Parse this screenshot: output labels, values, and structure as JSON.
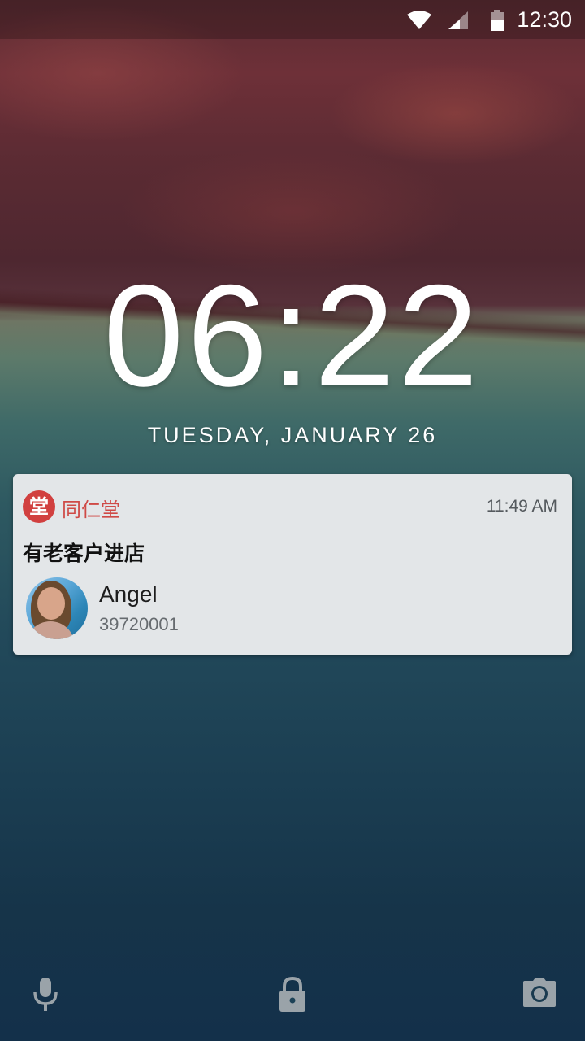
{
  "status_bar": {
    "time": "12:30",
    "icons": [
      "wifi-icon",
      "signal-icon",
      "battery-icon"
    ]
  },
  "lockscreen": {
    "clock": "06:22",
    "date": "TUESDAY, JANUARY 26"
  },
  "notification": {
    "app_icon": "tong-ren-tang-logo",
    "app_icon_glyph": "堂",
    "app_name": "同仁堂",
    "time": "11:49 AM",
    "title": "有老客户进店",
    "contact": {
      "name": "Angel",
      "number": "39720001"
    }
  },
  "bottom_actions": [
    "microphone-icon",
    "lock-icon",
    "camera-icon"
  ],
  "colors": {
    "notification_background": "#e3e6e8",
    "app_accent": "#cf4a46",
    "icon_tint": "#9aa3a9"
  }
}
